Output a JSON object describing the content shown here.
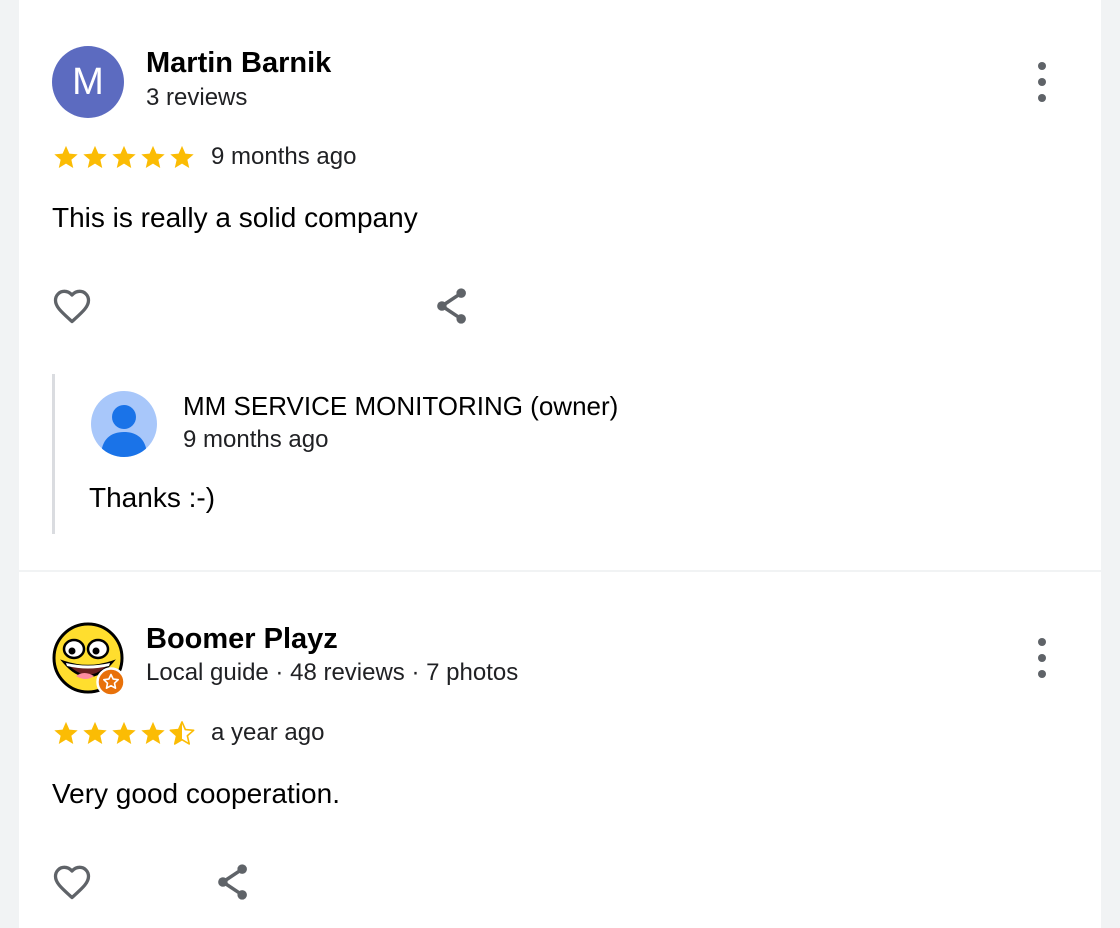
{
  "reviews": [
    {
      "reviewer": "Martin Barnik",
      "avatar_letter": "M",
      "meta": "3 reviews",
      "rating": 5,
      "time": "9 months ago",
      "text": "This is really a solid company",
      "owner_reply": {
        "name": "MM SERVICE MONITORING (owner)",
        "time": "9 months ago",
        "text": "Thanks :-)"
      }
    },
    {
      "reviewer": "Boomer Playz",
      "meta": "Local guide · 48 reviews · 7 photos",
      "rating": 4.5,
      "time": "a year ago",
      "text": "Very good cooperation."
    }
  ],
  "icons": {
    "more": "more-vert-icon",
    "like": "heart-outline-icon",
    "share": "share-icon",
    "star": "star-icon",
    "local_guide_badge": "local-guide-star-badge-icon"
  },
  "colors": {
    "star": "#fbbc04",
    "avatar_letter_bg": "#5c6bc0",
    "owner_avatar_bg": "#a8c7fa",
    "owner_avatar_figure": "#1a73e8",
    "icon": "#5f6368",
    "local_guide_badge": "#e8710a"
  }
}
